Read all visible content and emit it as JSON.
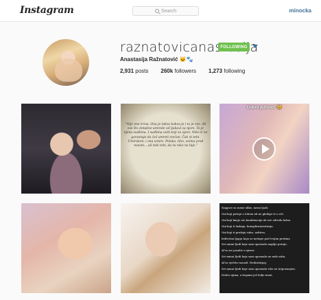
{
  "nav": {
    "logo": "Instagram",
    "search_placeholder": "Search",
    "user": "minocka"
  },
  "profile": {
    "username": "raznatovicanastasija",
    "follow_label": "FOLLOWING",
    "full_name": "Anastasija Ražnatović 🐱🐾",
    "posts_count": "2,931",
    "posts_label": "posts",
    "followers_count": "260k",
    "followers_label": "followers",
    "following_count": "1,273",
    "following_label": "following"
  },
  "posts": {
    "quote": "\"Nije ona kriva. Ona je takva kakva je i to je sve. Ali sve što dotakne umrede od ljubavi za njom. To je njena sudbina. I sudbina onih koji su njeni. Niko ti ne garantuje da ćeš umreti srećan. Čak ni tebi. Umiralom, i ona umire. Polako, tiho, ocima pred nosom... ali tebi tebi, da tu niko ne bije.\"",
    "video_caption": "Dobro jutrooo! 🐱",
    "poem_lines": [
      "Najgore su mene slike, mrmi ljudi.",
      "Oni koji putuju s tobom ali ne gledaje te u oči.",
      "Oni koji knajo sto kombinacija ali sve odredu lažne.",
      "Oni koji ti laskaju, konspliramentiraju.",
      "Oni koji ti pružaju ruku, uzbtiva,",
      "ledivetna ljapju koju se mrtnpe pod tvojim prstima",
      "Svi nmmi ljudi koje sam upoznala nagdje putuju.",
      "Aľ su ne pozalis s njesra.",
      "Svi mmui ljudi koje sam upoznala ne mde nitta.",
      "Aľ sa vječito razuzil. Nedostatpaj.",
      "Svi mmui ljudi koje sam upoznala više ne (n)poznajem.",
      "Dobro njima, a bogami još bolje meni."
    ]
  },
  "colors": {
    "follow_button": "#70c050",
    "link_blue": "#3f729b"
  }
}
